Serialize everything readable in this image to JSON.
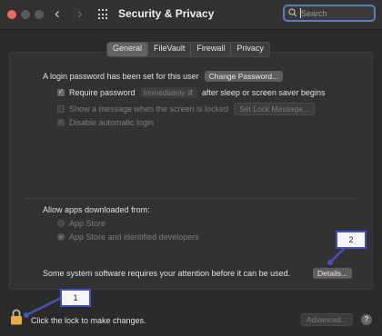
{
  "window": {
    "title": "Security & Privacy"
  },
  "search": {
    "placeholder": "Search"
  },
  "tabs": [
    "General",
    "FileVault",
    "Firewall",
    "Privacy"
  ],
  "general": {
    "login_text": "A login password has been set for this user",
    "change_password_label": "Change Password...",
    "require_password_label": "Require password",
    "require_password_interval": "Immediately",
    "require_password_suffix": "after sleep or screen saver begins",
    "show_message_label": "Show a message when the screen is locked",
    "set_lock_message_label": "Set Lock Message...",
    "disable_autologin_label": "Disable automatic login",
    "allow_apps_label": "Allow apps downloaded from:",
    "app_store_label": "App Store",
    "app_store_identified_label": "App Store and identified developers",
    "attention_text": "Some system software requires your attention before it can be used.",
    "details_label": "Details..."
  },
  "footer": {
    "lock_text": "Click the lock to make changes.",
    "advanced_label": "Advanced...",
    "help_label": "?"
  },
  "callouts": [
    "1",
    "2"
  ],
  "colors": {
    "accent": "#4650b8",
    "close_button": "#ec6a5e",
    "lock": "#e7ad44",
    "search_focus": "#5a7cc0"
  }
}
